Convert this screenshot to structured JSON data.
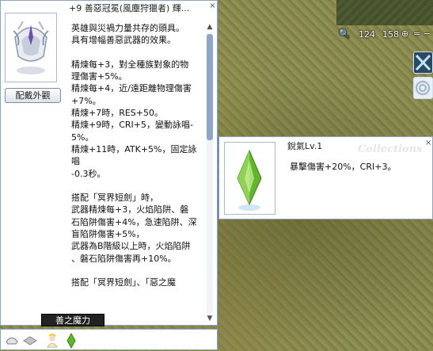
{
  "map": {
    "zoom_out": "🔍",
    "coord_x": "124",
    "coord_y": "158",
    "zoom_in": "⊕",
    "toggle_symbol": "=",
    "close_symbol": "−"
  },
  "item_window": {
    "title": "+9 善惡冠冕(風塵狩獵者) 輝...",
    "view_button_label": "配戴外觀",
    "close_symbol": "×",
    "description_lines": [
      "英雄與災禍力量共存的頭具。",
      "具有增幅善惡武器的效果。",
      "",
      "精煉每+3，對全種族對象的物",
      "理傷害+5%。",
      "精煉每+4，近/遠距離物理傷害",
      "+7%。",
      "精煉+7時，RES+50。",
      "精煉+9時，CRI+5，變動詠唱-",
      "5%。",
      "精煉+11時，ATK+5%，固定詠唱",
      "-0.3秒。",
      "",
      "搭配「冥界短劍」時，",
      "武器精煉每+3，火焰陷阱、磐",
      "石陷阱傷害+4%，急速陷阱、深",
      "盲陷阱傷害+5%，",
      "武器為B階級以上時，火焰陷阱",
      "、磐石陷阱傷害再+10%。",
      "",
      "搭配「冥界短劍」、「惡之魔"
    ],
    "scroll_up": "▲",
    "scroll_down": "▼"
  },
  "skill_window": {
    "name": "銳氣Lv.1",
    "watermark": "Collections",
    "close_symbol": "×",
    "description": "暴擊傷害+20%，CRI+3。"
  },
  "tooltip": {
    "text": "善之魔力"
  },
  "colors": {
    "window_border": "#8ea3bf",
    "scroll_thumb": "#8fa5c7",
    "gem_green": "#62b52f"
  },
  "icons": [
    "map-zoom-out-icon",
    "helmet-icon",
    "crystal-icon",
    "card-icon",
    "angel-doll-icon"
  ]
}
